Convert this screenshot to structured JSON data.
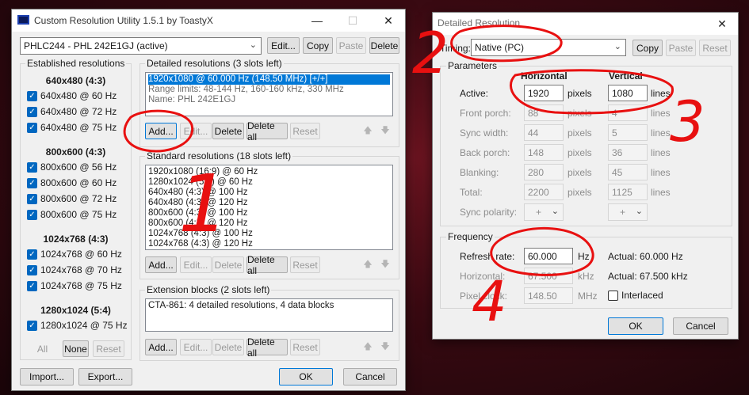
{
  "cru": {
    "title": "Custom Resolution Utility 1.5.1 by ToastyX",
    "monitor": "PHLC244 - PHL 242E1GJ (active)",
    "edit": "Edit...",
    "copy": "Copy",
    "paste": "Paste",
    "delete": "Delete",
    "established": {
      "title": "Established resolutions",
      "groups": [
        {
          "header": "640x480 (4:3)",
          "items": [
            "640x480 @ 60 Hz",
            "640x480 @ 72 Hz",
            "640x480 @ 75 Hz"
          ]
        },
        {
          "header": "800x600 (4:3)",
          "items": [
            "800x600 @ 56 Hz",
            "800x600 @ 60 Hz",
            "800x600 @ 72 Hz",
            "800x600 @ 75 Hz"
          ]
        },
        {
          "header": "1024x768 (4:3)",
          "items": [
            "1024x768 @ 60 Hz",
            "1024x768 @ 70 Hz",
            "1024x768 @ 75 Hz"
          ]
        },
        {
          "header": "1280x1024 (5:4)",
          "items": [
            "1280x1024 @ 75 Hz"
          ]
        }
      ],
      "all": "All",
      "none": "None",
      "reset": "Reset"
    },
    "detailed": {
      "title": "Detailed resolutions (3 slots left)",
      "rows": [
        "1920x1080 @ 60.000 Hz (148.50 MHz) [+/+]",
        "Range limits: 48-144 Hz, 160-160 kHz, 330 MHz",
        "Name: PHL 242E1GJ"
      ]
    },
    "standard": {
      "title": "Standard resolutions (18 slots left)",
      "rows": [
        "1920x1080 (16:9) @ 60 Hz",
        "1280x1024 (5:4) @ 60 Hz",
        "640x480 (4:3) @ 100 Hz",
        "640x480 (4:3) @ 120 Hz",
        "800x600 (4:3) @ 100 Hz",
        "800x600 (4:3) @ 120 Hz",
        "1024x768 (4:3) @ 100 Hz",
        "1024x768 (4:3) @ 120 Hz"
      ]
    },
    "extension": {
      "title": "Extension blocks (2 slots left)",
      "rows": [
        "CTA-861: 4 detailed resolutions, 4 data blocks"
      ]
    },
    "add": "Add...",
    "edit_btn": "Edit...",
    "delete_btn": "Delete",
    "delete_all": "Delete all",
    "reset_btn": "Reset",
    "import": "Import...",
    "export": "Export...",
    "ok": "OK",
    "cancel": "Cancel"
  },
  "dr": {
    "title": "Detailed Resolution",
    "timing_label": "Timing:",
    "timing_value": "Native (PC)",
    "copy": "Copy",
    "paste": "Paste",
    "reset": "Reset",
    "parameters": "Parameters",
    "horizontal": "Horizontal",
    "vertical": "Vertical",
    "rows": [
      {
        "label": "Active:",
        "h": "1920",
        "hu": "pixels",
        "v": "1080",
        "vu": "lines"
      },
      {
        "label": "Front porch:",
        "h": "88",
        "hu": "pixels",
        "v": "4",
        "vu": "lines"
      },
      {
        "label": "Sync width:",
        "h": "44",
        "hu": "pixels",
        "v": "5",
        "vu": "lines"
      },
      {
        "label": "Back porch:",
        "h": "148",
        "hu": "pixels",
        "v": "36",
        "vu": "lines"
      },
      {
        "label": "Blanking:",
        "h": "280",
        "hu": "pixels",
        "v": "45",
        "vu": "lines"
      },
      {
        "label": "Total:",
        "h": "2200",
        "hu": "pixels",
        "v": "1125",
        "vu": "lines"
      }
    ],
    "sync_polarity": "Sync polarity:",
    "pol_h": "+",
    "pol_v": "+",
    "frequency": "Frequency",
    "refresh_label": "Refresh rate:",
    "refresh_value": "60.000",
    "hz": "Hz",
    "actual_refresh": "Actual: 60.000 Hz",
    "horizontal_label": "Horizontal:",
    "horizontal_value": "67.500",
    "khz": "kHz",
    "actual_h": "Actual: 67.500 kHz",
    "pixel_clock_label": "Pixel clock:",
    "pixel_clock_value": "148.50",
    "mhz": "MHz",
    "interlaced": "Interlaced",
    "ok": "OK",
    "cancel": "Cancel"
  },
  "annotations": {
    "n1": "1",
    "n2": "2",
    "n3": "3",
    "n4": "4",
    "color": "#e81010"
  },
  "colors": {
    "accent": "#0078d7",
    "check": "#0067c0"
  }
}
